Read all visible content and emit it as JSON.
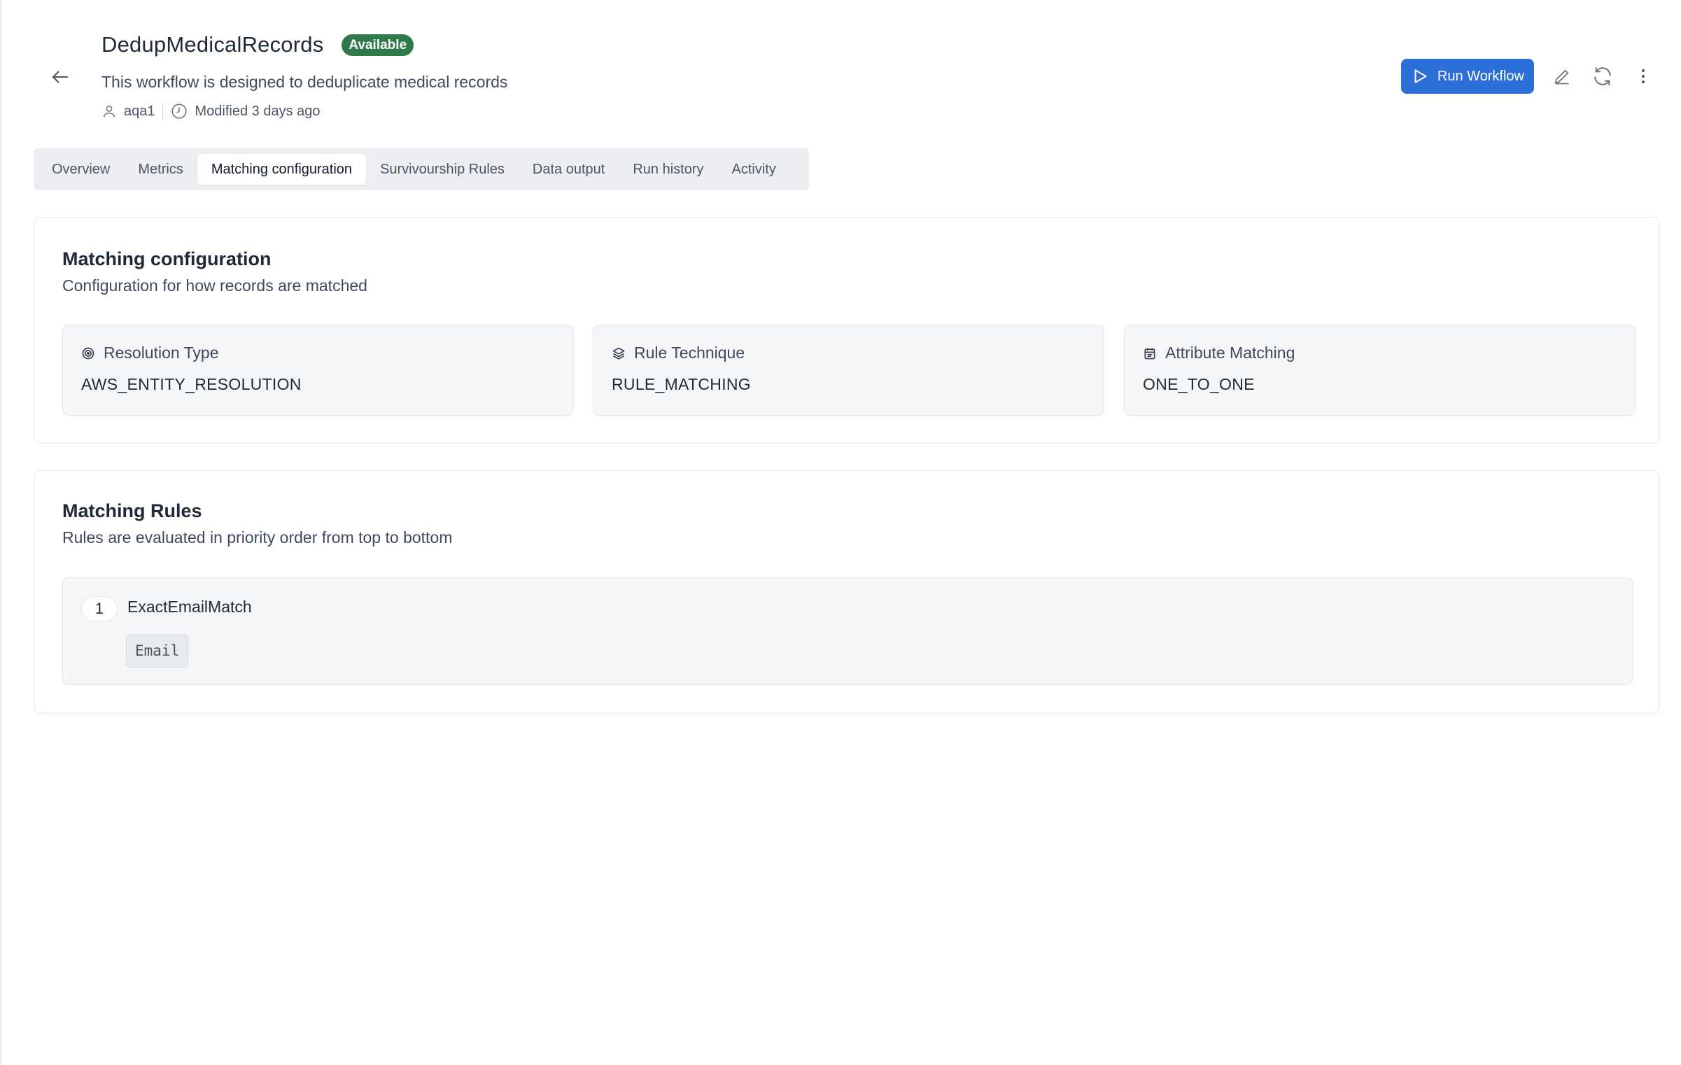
{
  "header": {
    "title": "DedupMedicalRecords",
    "status": "Available",
    "description": "This workflow is designed to deduplicate medical records",
    "owner": "aqa1",
    "modified": "Modified 3 days ago"
  },
  "actions": {
    "run_label": "Run Workflow"
  },
  "tabs": [
    {
      "label": "Overview"
    },
    {
      "label": "Metrics"
    },
    {
      "label": "Matching configuration",
      "active": true
    },
    {
      "label": "Survivourship Rules"
    },
    {
      "label": "Data output"
    },
    {
      "label": "Run history"
    },
    {
      "label": "Activity"
    }
  ],
  "matching_config": {
    "title": "Matching configuration",
    "subtitle": "Configuration for how records are matched",
    "items": [
      {
        "label": "Resolution Type",
        "value": "AWS_ENTITY_RESOLUTION",
        "icon": "target-icon"
      },
      {
        "label": "Rule Technique",
        "value": "RULE_MATCHING",
        "icon": "layers-icon"
      },
      {
        "label": "Attribute Matching",
        "value": "ONE_TO_ONE",
        "icon": "calendar-icon"
      }
    ]
  },
  "matching_rules": {
    "title": "Matching Rules",
    "subtitle": "Rules are evaluated in priority order from top to bottom",
    "rules": [
      {
        "priority": "1",
        "name": "ExactEmailMatch",
        "attributes": [
          "Email"
        ]
      }
    ]
  },
  "colors": {
    "primary": "#2d6fd8",
    "status_available": "#2f7a4a",
    "tab_bar": "#eceef2",
    "box_bg": "#f5f6f8"
  }
}
